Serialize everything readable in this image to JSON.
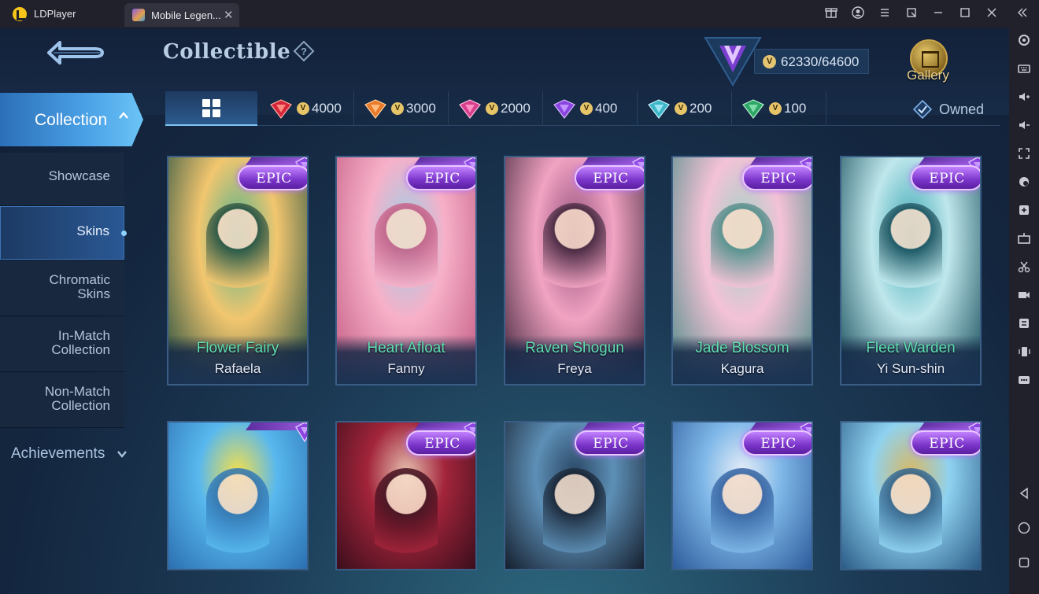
{
  "window": {
    "app_name": "LDPlayer",
    "tab_title": "Mobile Legen...",
    "tab_close": "✕",
    "controls": [
      "gift-icon",
      "account-icon",
      "menu-icon",
      "restore-icon",
      "minimize-icon",
      "maximize-icon",
      "close-icon",
      "collapse-icon"
    ]
  },
  "header": {
    "title": "Collectible",
    "help": "?",
    "score": "62330/64600",
    "gallery_label": "Gallery"
  },
  "nav": {
    "collection": "Collection",
    "items": [
      {
        "label": "Showcase"
      },
      {
        "label": "Skins"
      },
      {
        "label": "Chromatic Skins"
      },
      {
        "label": "In-Match Collection"
      },
      {
        "label": "Non-Match Collection"
      }
    ],
    "achievements": "Achievements"
  },
  "filters": {
    "prices": [
      "4000",
      "3000",
      "2000",
      "400",
      "200",
      "100"
    ],
    "gem_colors": [
      "#d7263b",
      "#e87a2a",
      "#d83f8c",
      "#8a44e0",
      "#3fb6c8",
      "#2da765"
    ],
    "owned": "Owned"
  },
  "cards": [
    {
      "badge": "EPIC",
      "skin": "Flower Fairy",
      "hero": "Rafaela",
      "art": [
        "#f2c66f",
        "#4fb18e",
        "#1d4a3e"
      ]
    },
    {
      "badge": "EPIC",
      "skin": "Heart Afloat",
      "hero": "Fanny",
      "art": [
        "#f7b0c8",
        "#9ad0e8",
        "#c25a82"
      ]
    },
    {
      "badge": "EPIC",
      "skin": "Raven Shogun",
      "hero": "Freya",
      "art": [
        "#f2a3c2",
        "#8e4d7a",
        "#3c2238"
      ]
    },
    {
      "badge": "EPIC",
      "skin": "Jade Blossom",
      "hero": "Kagura",
      "art": [
        "#f4c2d6",
        "#9ed3c5",
        "#4a8a86"
      ]
    },
    {
      "badge": "EPIC",
      "skin": "Fleet Warden",
      "hero": "Yi Sun-shin",
      "art": [
        "#bfe7ec",
        "#3aa6b2",
        "#134a57"
      ]
    },
    {
      "badge": "",
      "skin": "",
      "hero": "",
      "art": [
        "#58b8ee",
        "#f6e04a",
        "#2b6fb0"
      ]
    },
    {
      "badge": "EPIC",
      "skin": "",
      "hero": "",
      "art": [
        "#a2243a",
        "#e6c0b0",
        "#3a0e1c"
      ]
    },
    {
      "badge": "EPIC",
      "skin": "",
      "hero": "",
      "art": [
        "#5d8fb6",
        "#2a4663",
        "#151f2e"
      ]
    },
    {
      "badge": "EPIC",
      "skin": "",
      "hero": "",
      "art": [
        "#7fb8e8",
        "#e8eef8",
        "#2d5b9b"
      ]
    },
    {
      "badge": "EPIC",
      "skin": "",
      "hero": "",
      "art": [
        "#8fd2f0",
        "#d9b864",
        "#2a5b86"
      ]
    }
  ]
}
